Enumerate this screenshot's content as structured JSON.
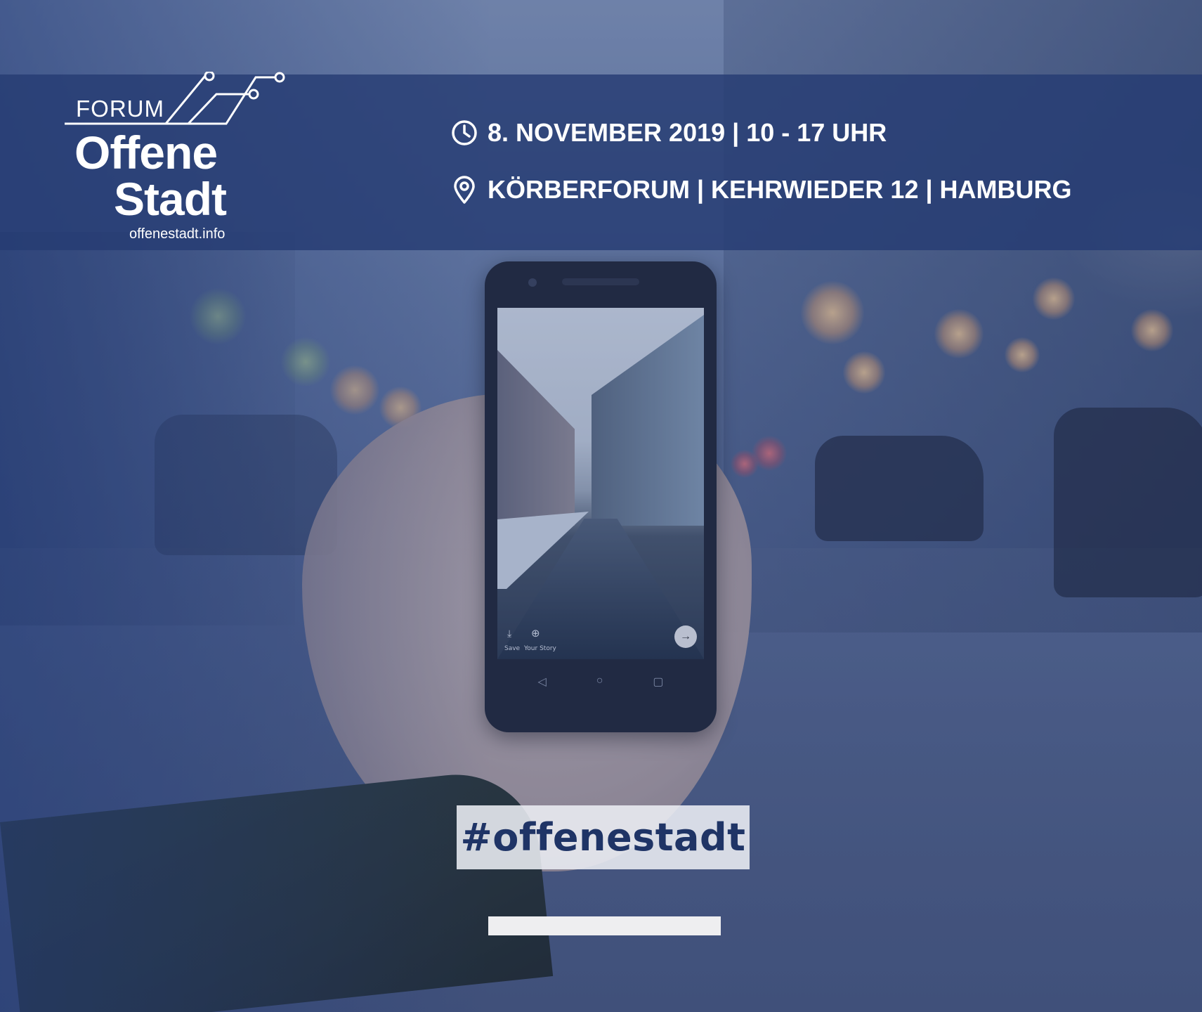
{
  "logo": {
    "forum": "FORUM",
    "title_line1": "Offene",
    "title_line2": "Stadt",
    "url": "offenestadt.info"
  },
  "event": {
    "date_icon": "clock-icon",
    "date": "8. NOVEMBER 2019 | 10 - 17 UHR",
    "location_icon": "location-pin-icon",
    "location": "KÖRBERFORUM | KEHRWIEDER 12 | HAMBURG"
  },
  "phone_screen": {
    "save_label": "Save",
    "story_label": "Your Story"
  },
  "hashtag": "#offenestadt",
  "colors": {
    "band": "#263c73",
    "hashtag_text": "#1f3466",
    "hashtag_box": "#eceef4"
  }
}
